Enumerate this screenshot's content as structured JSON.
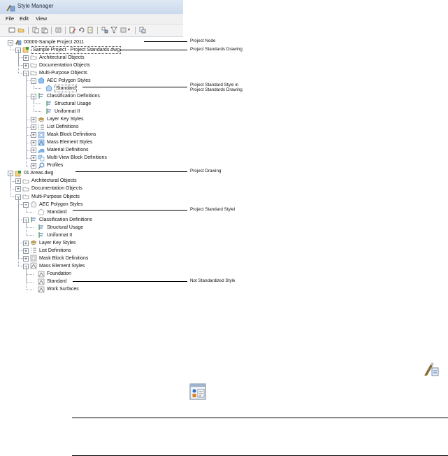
{
  "window": {
    "title": "Style Manager",
    "menus": [
      "File",
      "Edit",
      "View"
    ]
  },
  "tree": [
    {
      "indent": 0,
      "box": "-",
      "icon": "project",
      "label": "00000-Sample Project 2011"
    },
    {
      "indent": 1,
      "box": "-",
      "icon": "drawing",
      "label": "Sample Project - Project Standards.dwg",
      "selected": true
    },
    {
      "indent": 2,
      "box": "+",
      "icon": "folder",
      "label": "Architectural Objects"
    },
    {
      "indent": 2,
      "box": "+",
      "icon": "folder",
      "label": "Documentation Objects"
    },
    {
      "indent": 2,
      "box": "-",
      "icon": "folder",
      "label": "Multi-Purpose Objects"
    },
    {
      "indent": 3,
      "box": "-",
      "icon": "polygon",
      "label": "AEC Polygon Styles"
    },
    {
      "indent": 4,
      "box": "",
      "icon": "polygon-style",
      "label": "Standard",
      "selected": true
    },
    {
      "indent": 3,
      "box": "-",
      "icon": "classification",
      "label": "Classification Definitions"
    },
    {
      "indent": 4,
      "box": "",
      "icon": "classification",
      "label": "Structural Usage"
    },
    {
      "indent": 4,
      "box": "",
      "icon": "classification",
      "label": "Uniformat II"
    },
    {
      "indent": 3,
      "box": "+",
      "icon": "layer-key",
      "label": "Layer Key Styles"
    },
    {
      "indent": 3,
      "box": "+",
      "icon": "list",
      "label": "List Definitions"
    },
    {
      "indent": 3,
      "box": "+",
      "icon": "mask",
      "label": "Mask Block Definitions"
    },
    {
      "indent": 3,
      "box": "+",
      "icon": "mass",
      "label": "Mass Element Styles"
    },
    {
      "indent": 3,
      "box": "+",
      "icon": "material",
      "label": "Material Definitions"
    },
    {
      "indent": 3,
      "box": "+",
      "icon": "multiview",
      "label": "Multi-View Block Definitions"
    },
    {
      "indent": 3,
      "box": "+",
      "icon": "profile",
      "label": "Profiles"
    },
    {
      "indent": 0,
      "box": "-",
      "icon": "drawing",
      "label": "01 Areas.dwg"
    },
    {
      "indent": 1,
      "box": "+",
      "icon": "folder",
      "label": "Architectural Objects"
    },
    {
      "indent": 1,
      "box": "+",
      "icon": "folder",
      "label": "Documentation Objects"
    },
    {
      "indent": 1,
      "box": "-",
      "icon": "folder",
      "label": "Multi-Purpose Objects"
    },
    {
      "indent": 2,
      "box": "-",
      "icon": "polygon-gray",
      "label": "AEC Polygon Styles"
    },
    {
      "indent": 3,
      "box": "",
      "icon": "polygon-style-gray",
      "label": "Standard"
    },
    {
      "indent": 2,
      "box": "-",
      "icon": "classification",
      "label": "Classification Definitions"
    },
    {
      "indent": 3,
      "box": "",
      "icon": "classification",
      "label": "Structural Usage"
    },
    {
      "indent": 3,
      "box": "",
      "icon": "classification",
      "label": "Uniformat II"
    },
    {
      "indent": 2,
      "box": "+",
      "icon": "layer-key",
      "label": "Layer Key Styles"
    },
    {
      "indent": 2,
      "box": "+",
      "icon": "list",
      "label": "List Definitions"
    },
    {
      "indent": 2,
      "box": "+",
      "icon": "mask-gray",
      "label": "Mask Block Definitions"
    },
    {
      "indent": 2,
      "box": "-",
      "icon": "mass-gray",
      "label": "Mass Element Styles"
    },
    {
      "indent": 3,
      "box": "",
      "icon": "mass-gray",
      "label": "Foundation"
    },
    {
      "indent": 3,
      "box": "",
      "icon": "mass-gray",
      "label": "Standard"
    },
    {
      "indent": 3,
      "box": "",
      "icon": "mass-gray",
      "label": "Work Surfaces"
    }
  ],
  "callouts": {
    "project_node": "Project Node",
    "project_standards_drawing": "Project Standards Drawing",
    "project_standard_style_1": "Project Standard Style in",
    "project_standard_style_2": "Project Standards Drawing",
    "project_drawing": "Project Drawing",
    "project_standard_style": "Project Standard Stylel",
    "not_standardized": "Not Standardized Style"
  }
}
